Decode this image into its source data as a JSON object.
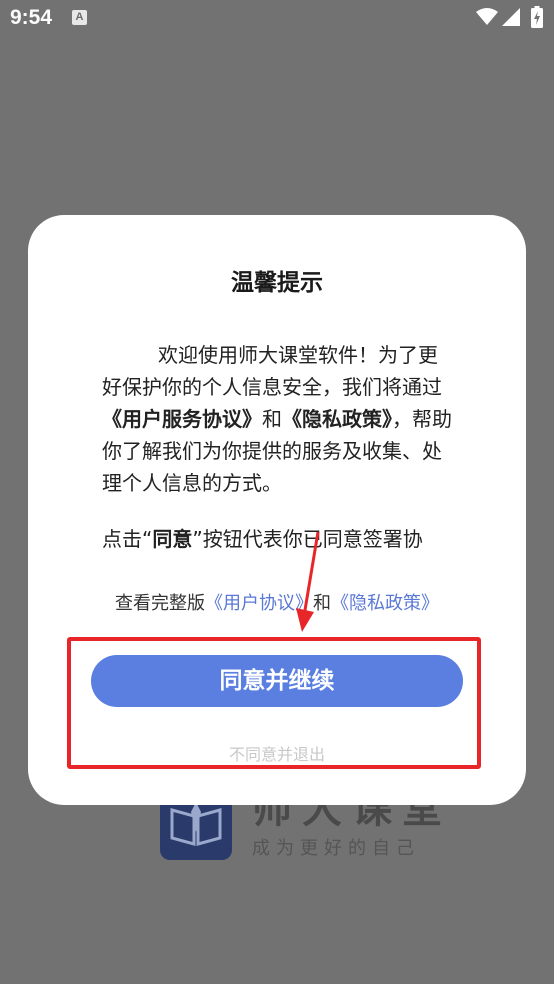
{
  "status_bar": {
    "time": "9:54",
    "notification_icon_letter": "A",
    "icons": [
      "wifi-icon",
      "signal-icon",
      "battery-charging-icon"
    ]
  },
  "background_app": {
    "name": "师大课堂",
    "slogan": "成为更好的自己",
    "logo_color": "#2a3a6a"
  },
  "dialog": {
    "title": "温馨提示",
    "body_prefix": "欢迎使用师大课堂软件！为了更好保护你的个人信息安全，我们将通过",
    "user_agreement_bold": "《用户服务协议》",
    "and_1": "和",
    "privacy_policy_bold": "《隐私政策》",
    "body_suffix": "，帮助你了解我们为你提供的服务及收集、处理个人信息的方式。",
    "consent_prefix": "点击“",
    "consent_bold": "同意",
    "consent_suffix": "”按钮代表你已同意签署协",
    "links_prefix": "查看完整版",
    "link_user_agreement": "《用户协议》",
    "and_2": "和",
    "link_privacy_policy": "《隐私政策》",
    "agree_label": "同意并继续",
    "disagree_label": "不同意并退出"
  },
  "colors": {
    "accent": "#5a7fe0",
    "link": "#5a78d6",
    "annotation": "#e8262a",
    "overlay": "#727272"
  }
}
